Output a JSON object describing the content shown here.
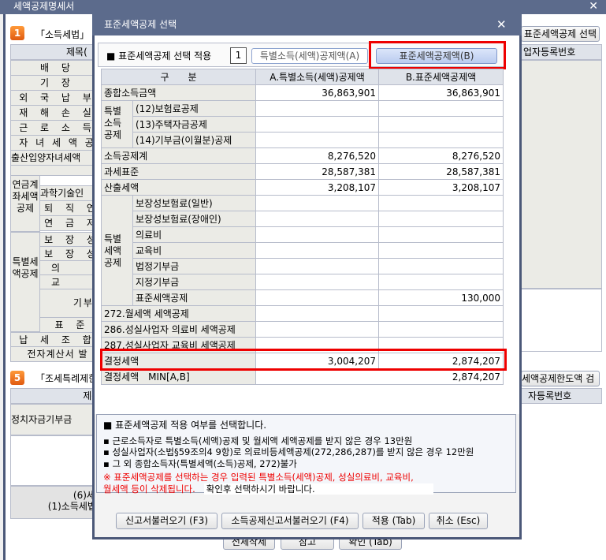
{
  "main": {
    "title": "세액공제명세서",
    "close": "✕",
    "section1_num": "1",
    "section1_title": "「소득세법」",
    "section5_num": "5",
    "section5_title": "「조세특례제한",
    "btn_std": "표준세액공제 선택",
    "btn_limit": "세액공제한도액 검증",
    "col_title": "제목(",
    "col_bizno": "업자등록번호",
    "col_bizno2": "자등록번호",
    "rows": [
      "배 당",
      "기 장",
      "외 국 납 부",
      "재 해 손 실",
      "근 로 소 득",
      "자 녀 세 액 공",
      "출산입양자녀세액"
    ],
    "pension_group": "연금계좌세액공제",
    "pension_rows": [
      "과학기술인",
      "퇴 직 연",
      "연 금 저"
    ],
    "special_group": "특별세액공제",
    "special_rows": [
      "보 장 성",
      "보 장 성",
      "의",
      "교",
      "기부금",
      "표 준"
    ],
    "tail_rows": [
      "납 세 조 합",
      "전자계산서 발"
    ],
    "political": "정치자금기부금",
    "sum1": "(6)세액",
    "sum2": "(1)소득세법+",
    "bottom_buttons": [
      "전체삭제",
      "참고",
      "확인 (Tab)"
    ]
  },
  "dialog": {
    "title": "표준세액공제 선택",
    "close": "✕",
    "apply_label": "■ 표준세액공제 선택 적용",
    "apply_value": "1",
    "option_a": "특별소득(세액)공제액(A)",
    "option_b": "표준세액공제액(B)",
    "headers": [
      "구　　분",
      "A.특별소득(세액)공제액",
      "B.표준세액공제액"
    ],
    "rows": {
      "total_income": {
        "label": "종합소득금액",
        "a": "36,863,901",
        "b": "36,863,901"
      },
      "special_income_group": "특별소득공제",
      "special_income": [
        {
          "label": "(12)보험료공제",
          "a": "",
          "b": ""
        },
        {
          "label": "(13)주택자금공제",
          "a": "",
          "b": ""
        },
        {
          "label": "(14)기부금(이월분)공제",
          "a": "",
          "b": ""
        }
      ],
      "income_ded_total": {
        "label": "소득공제계",
        "a": "8,276,520",
        "b": "8,276,520"
      },
      "tax_base": {
        "label": "과세표준",
        "a": "28,587,381",
        "b": "28,587,381"
      },
      "calc_tax": {
        "label": "산출세액",
        "a": "3,208,107",
        "b": "3,208,107"
      },
      "special_tax_group": "특별세액공제",
      "special_tax": [
        {
          "label": "보장성보험료(일반)",
          "a": "",
          "b": ""
        },
        {
          "label": "보장성보험료(장애인)",
          "a": "",
          "b": ""
        },
        {
          "label": "의료비",
          "a": "",
          "b": ""
        },
        {
          "label": "교육비",
          "a": "",
          "b": ""
        },
        {
          "label": "법정기부금",
          "a": "",
          "b": ""
        },
        {
          "label": "지정기부금",
          "a": "",
          "b": ""
        },
        {
          "label": "표준세액공제",
          "a": "",
          "b": "130,000"
        }
      ],
      "others": [
        {
          "label": "272.월세액 세액공제",
          "a": "",
          "b": ""
        },
        {
          "label": "286.성실사업자 의료비 세액공제",
          "a": "",
          "b": ""
        },
        {
          "label": "287.성실사업자 교육비 세액공제",
          "a": "",
          "b": ""
        }
      ],
      "final_tax": {
        "label": "결정세액",
        "a": "3,004,207",
        "b": "2,874,207"
      },
      "final_min": {
        "label": "결정세액　MIN[A,B]",
        "value": "2,874,207"
      }
    },
    "info": {
      "heading": "■ 표준세액공제 적용 여부를 선택합니다.",
      "bullets": [
        "▪ 근로소득자로 특별소득(세액)공제 및 월세액 세액공제를 받지 않은 경우 13만원",
        "▪ 성실사업자(소법§59조의4 9항)로 의료비등세액공제(272,286,287)를 받지 않은 경우 12만원",
        "▪ 그 외 종합소득자(특별세액(소득)공제, 272)불가"
      ],
      "warning1": "※ 표준세액공제를 선택하는 경우 입력된 특별소득(세액)공제, 성실의료비, 교육비,",
      "warning2": "월세액 등이 삭제됩니다.",
      "confirm": "확인후 선택하시기 바랍니다."
    },
    "buttons": {
      "load_return": "신고서불러오기 (F3)",
      "load_deduction": "소득공제신고서불러오기 (F4)",
      "apply": "적용 (Tab)",
      "cancel": "취소 (Esc)"
    },
    "highlight_color": "#ee0000"
  }
}
